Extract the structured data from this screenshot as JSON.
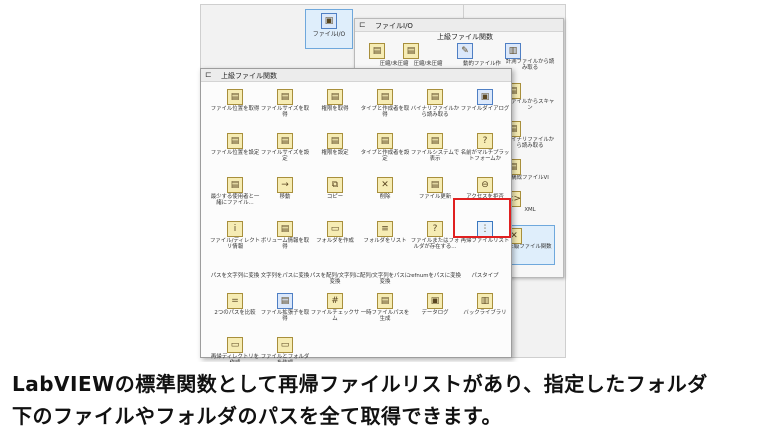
{
  "back_palette": {
    "file_io_label": "ファイルI/O"
  },
  "middle_palette": {
    "title": "ファイルI/O",
    "subtitle": "上級ファイル関数",
    "top_items": [
      "圧縮/未圧縮",
      "圧縮/未圧縮",
      "動的ファイル作",
      "計測ファイルから読み取る"
    ],
    "right_items": [
      "計測ファイルから読み取る",
      "ファイルからスキャン",
      "バイナリファイルから読み取る",
      "構成ファイルVI",
      "XML",
      "上級ファイル関数"
    ]
  },
  "front_palette": {
    "title": "上級ファイル関数",
    "items": [
      "ファイル位置を取得",
      "ファイルサイズを取得",
      "権限を取得",
      "タイプと作成者を取得",
      "バイナリファイルから読み取る",
      "ファイルダイアログ",
      "ファイル位置を設定",
      "ファイルサイズを設定",
      "権限を設定",
      "タイプと作成者を設定",
      "ファイルシステムで表示",
      "名前がマルチプラットフォームか",
      "最少する使用者と一緒にファイル...",
      "移動",
      "コピー",
      "削除",
      "ファイル更新",
      "アクセスを拒否",
      "ファイル/ディレクトリ情報",
      "ボリューム情報を取得",
      "フォルダを作成",
      "フォルダをリスト",
      "ファイルまたはフォルダが存在する...",
      "再帰ファイルリスト",
      "パスを文字列に変換",
      "文字列をパスに変換",
      "パスを配列/文字列に変換",
      "配列/文字列をパスに変換",
      "refnumをパスに変換",
      "パスタイプ",
      "2つのパスを比較",
      "ファイル拡張子を取得",
      "ファイルチェックサム",
      "一時ファイルパスを生成",
      "データログ",
      "バックライブラリ",
      "再帰ディレクトリを作成",
      "ファイルとフォルダを作成"
    ],
    "highlighted_item": "再帰ファイルリスト"
  },
  "caption": {
    "line1": "LabVIEWの標準関数として再帰ファイルリストがあり、指定したフォルダ",
    "line2": "下のファイルやフォルダのパスを全て取得できます。"
  },
  "colors": {
    "highlight": "#e02020",
    "icon_fill": "#f6ecb4",
    "selected_tile": "#dfeefb"
  },
  "icons": [
    "floppy-disk-icon",
    "file-icon",
    "folder-icon",
    "pin-icon"
  ]
}
